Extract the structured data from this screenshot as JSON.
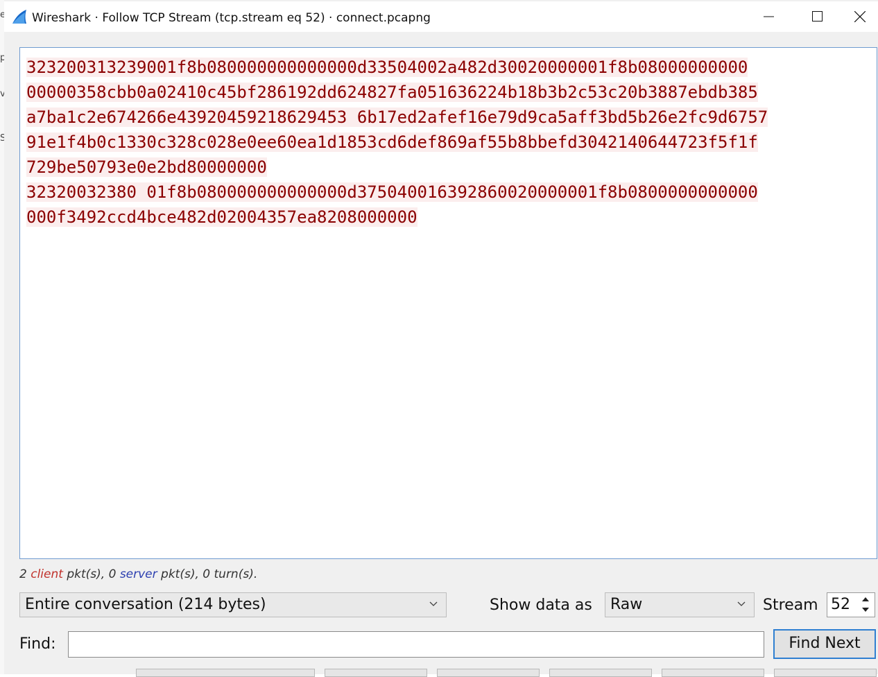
{
  "window": {
    "title": "Wireshark · Follow TCP Stream (tcp.stream eq 52) · connect.pcapng",
    "icon": "wireshark-fin-icon"
  },
  "background_window": {
    "chars": [
      "e",
      "p",
      "v",
      "S"
    ]
  },
  "stream": {
    "lines": [
      "323200313239001f8b080000000000000d33504002a482d30020000001f8b08000000000",
      "00000358cbb0a02410c45bf286192dd624827fa051636224b18b3b2c53c20b3887ebdb385",
      "a7ba1c2e674266e43920459218629453 6b17ed2afef16e79d9ca5aff3bd5b26e2fc9d6757",
      "91e1f4b0c1330c328c028e0ee60ea1d1853cd6def869af55b8bbefd3042140644723f5f1f",
      "729be50793e0e2bd80000000",
      "32320032380 01f8b080000000000000d375040016392860020000001f8b0800000000000",
      "000f3492ccd4bce482d02004357ea8208000000"
    ],
    "text_color": "#8b0000",
    "highlight_color": "#fbeded"
  },
  "summary": {
    "count_client": "2",
    "client_word": "client",
    "mid1": " pkt(s), ",
    "count_server": "0",
    "server_word": "server",
    "mid2": " pkt(s), ",
    "tail": "0 turn(s)."
  },
  "controls": {
    "conversation_value": "Entire conversation (214 bytes)",
    "show_data_label": "Show data as",
    "show_data_value": "Raw",
    "stream_label": "Stream",
    "stream_value": "52",
    "find_label": "Find:",
    "find_value": "",
    "find_next_label": "Find Next"
  }
}
